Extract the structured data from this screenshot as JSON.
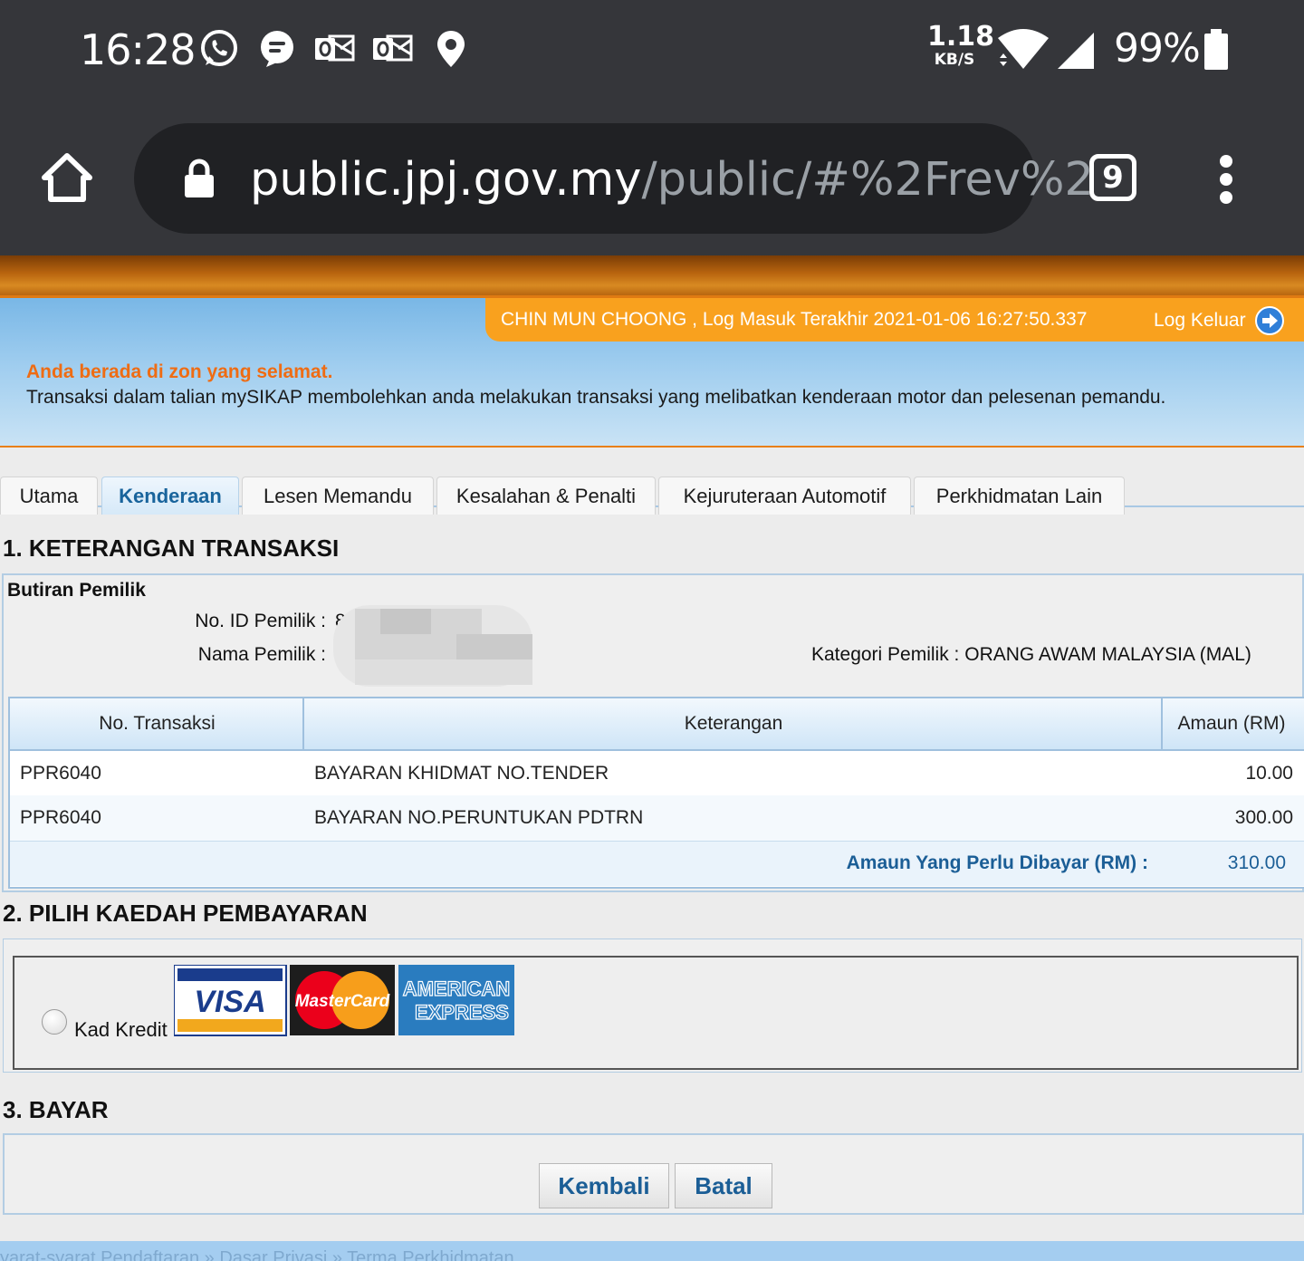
{
  "status_bar": {
    "time": "16:28",
    "net_speed_value": "1.18",
    "net_speed_unit": "KB/S",
    "battery": "99%",
    "notification_icons": [
      "whatsapp-icon",
      "chat-icon",
      "outlook-icon",
      "outlook-icon",
      "location-pin-icon"
    ]
  },
  "browser": {
    "url_host": "public.jpj.gov.my",
    "url_path": "/public/#%2Frev%2",
    "tab_count": "9"
  },
  "header": {
    "user_info": "CHIN MUN CHOONG , Log Masuk Terakhir 2021-01-06 16:27:50.337",
    "logout_label": "Log Keluar",
    "safe_zone": "Anda berada di zon yang selamat.",
    "description": "Transaksi dalam talian mySIKAP membolehkan anda melakukan transaksi yang melibatkan kenderaan motor dan pelesenan pemandu."
  },
  "tabs": [
    {
      "label": "Utama",
      "active": false
    },
    {
      "label": "Kenderaan",
      "active": true
    },
    {
      "label": "Lesen Memandu",
      "active": false
    },
    {
      "label": "Kesalahan & Penalti",
      "active": false
    },
    {
      "label": "Kejuruteraan Automotif",
      "active": false
    },
    {
      "label": "Perkhidmatan Lain",
      "active": false
    }
  ],
  "section1": {
    "title": "1. KETERANGAN TRANSAKSI",
    "owner_title": "Butiran Pemilik",
    "id_label": "No. ID Pemilik :",
    "id_value_partial": "8",
    "name_label": "Nama Pemilik :",
    "category_label": "Kategori Pemilik :",
    "category_value": "ORANG AWAM MALAYSIA (MAL)"
  },
  "transactions": {
    "headers": [
      "No. Transaksi",
      "Keterangan",
      "Amaun (RM)"
    ],
    "rows": [
      {
        "no": "PPR6040",
        "desc": "BAYARAN KHIDMAT NO.TENDER",
        "amount": "10.00"
      },
      {
        "no": "PPR6040",
        "desc": "BAYARAN NO.PERUNTUKAN PDTRN",
        "amount": "300.00"
      }
    ],
    "total_label": "Amaun Yang Perlu Dibayar (RM) :",
    "total_value": "310.00"
  },
  "section2": {
    "title": "2. PILIH KAEDAH PEMBAYARAN",
    "option_label": "Kad Kredit",
    "card_logos": {
      "visa": "VISA",
      "mastercard": "MasterCard",
      "amex_line1": "AMERICAN",
      "amex_line2": "EXPRESS"
    }
  },
  "section3": {
    "title": "3. BAYAR",
    "back_label": "Kembali",
    "cancel_label": "Batal"
  },
  "footer": {
    "text": "yarat-syarat Pendaftaran » Dasar Privasi » Terma Perkhidmatan"
  },
  "colors": {
    "chrome_bg": "#35363a",
    "url_bg": "#202124",
    "accent_orange": "#f9a11e",
    "info_blue": "#9fcdef",
    "link_blue": "#1b5e96"
  }
}
